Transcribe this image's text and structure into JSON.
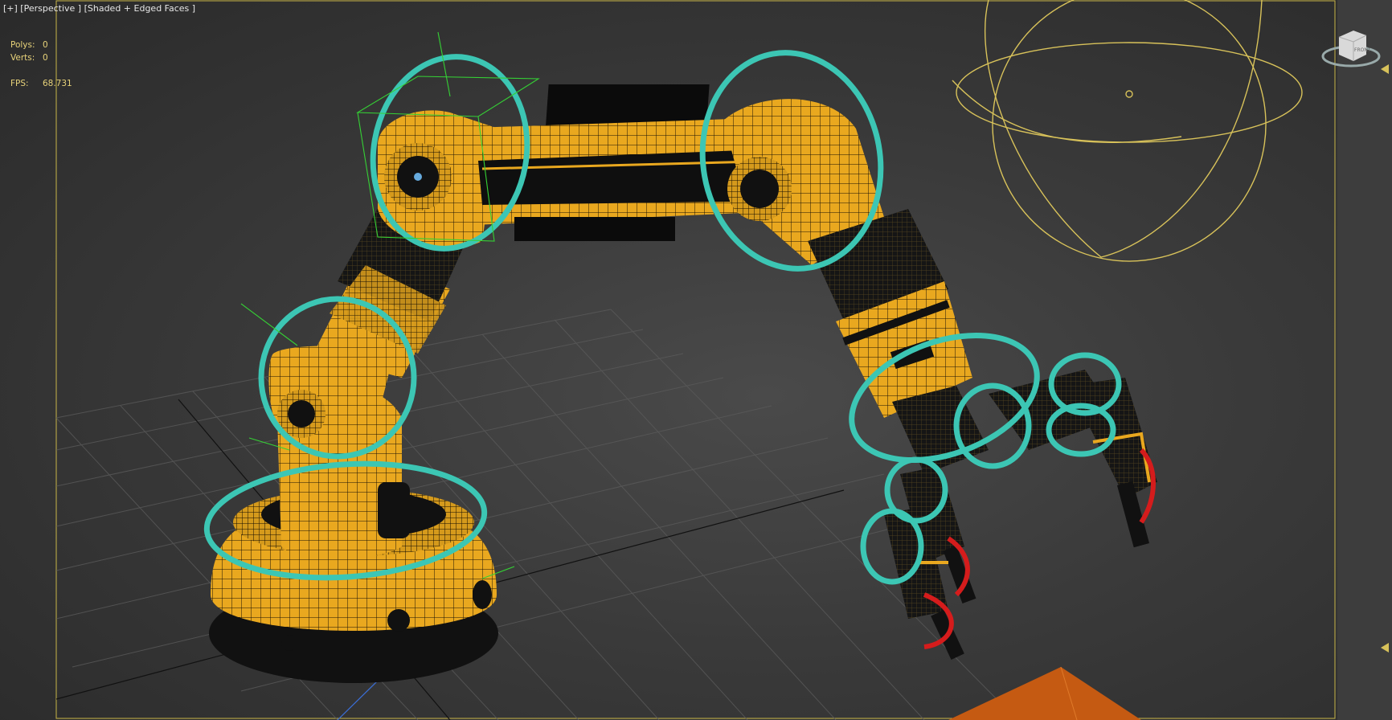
{
  "viewport": {
    "label": "[+] [Perspective ] [Shaded + Edged Faces ]"
  },
  "stats": {
    "polys_label": "Polys:",
    "polys_value": "0",
    "verts_label": "Verts:",
    "verts_value": "0",
    "fps_label": "FPS:",
    "fps_value": "68.731"
  },
  "viewcube": {
    "face_label": "FRONT",
    "icon": "viewcube-icon"
  },
  "colors": {
    "arm_yellow": "#e9a81f",
    "control_cyan": "#3cc6b4",
    "control_red": "#d51c1c",
    "light_gizmo": "#d8c25a",
    "viewport_border": "#c8b547"
  }
}
